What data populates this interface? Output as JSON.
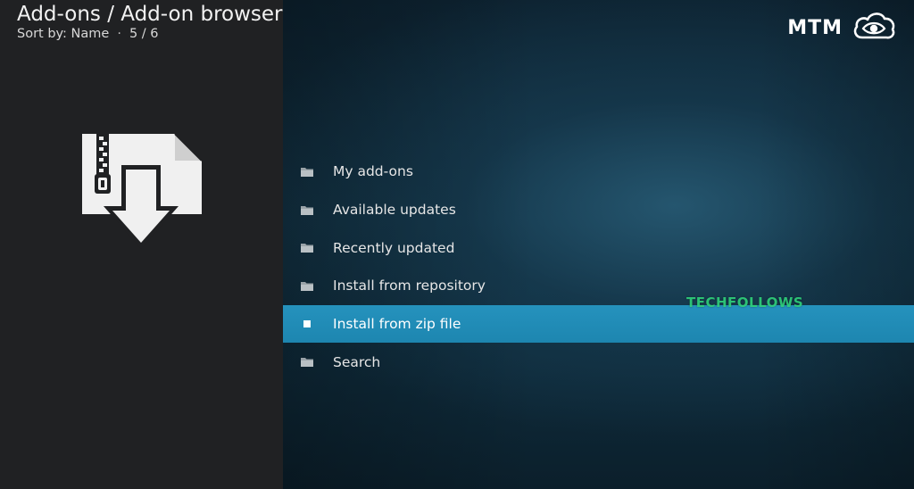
{
  "header": {
    "title": "Add-ons / Add-on browser",
    "sort_label": "Sort by: Name",
    "separator": "·",
    "position": "5 / 6"
  },
  "brand": {
    "text": "MTM",
    "icon": "cloud-eye-icon"
  },
  "preview": {
    "icon": "zip-install-icon"
  },
  "menu": {
    "items": [
      {
        "label": "My add-ons",
        "icon": "folder-icon",
        "selected": false
      },
      {
        "label": "Available updates",
        "icon": "folder-icon",
        "selected": false
      },
      {
        "label": "Recently updated",
        "icon": "folder-icon",
        "selected": false
      },
      {
        "label": "Install from repository",
        "icon": "folder-icon",
        "selected": false
      },
      {
        "label": "Install from zip file",
        "icon": "square-bullet-icon",
        "selected": true
      },
      {
        "label": "Search",
        "icon": "folder-icon",
        "selected": false
      }
    ]
  },
  "watermark": {
    "text": "TECHFOLLOWS"
  },
  "colors": {
    "selection": "#1f8fba",
    "left_pane": "#202123",
    "watermark": "#2fd17a"
  }
}
